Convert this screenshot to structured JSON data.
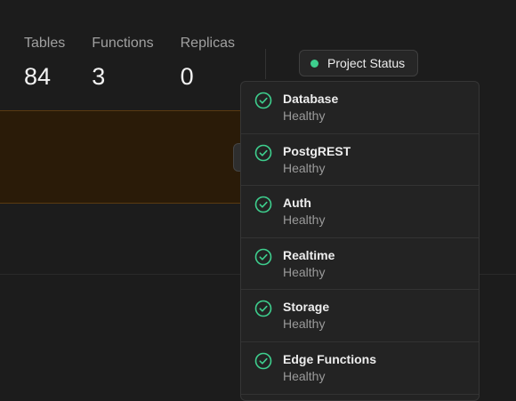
{
  "stats": [
    {
      "label": "Tables",
      "value": "84"
    },
    {
      "label": "Functions",
      "value": "3"
    },
    {
      "label": "Replicas",
      "value": "0"
    }
  ],
  "status_button": {
    "label": "Project Status",
    "dot_color": "#3ecf8e"
  },
  "services": [
    {
      "name": "Database",
      "status": "Healthy",
      "icon": "check-circle-icon"
    },
    {
      "name": "PostgREST",
      "status": "Healthy",
      "icon": "check-circle-icon"
    },
    {
      "name": "Auth",
      "status": "Healthy",
      "icon": "check-circle-icon"
    },
    {
      "name": "Realtime",
      "status": "Healthy",
      "icon": "check-circle-icon"
    },
    {
      "name": "Storage",
      "status": "Healthy",
      "icon": "check-circle-icon"
    },
    {
      "name": "Edge Functions",
      "status": "Healthy",
      "icon": "check-circle-icon"
    }
  ],
  "colors": {
    "accent": "#3ecf8e",
    "background": "#1c1c1c",
    "banner": "#2a1b08"
  }
}
